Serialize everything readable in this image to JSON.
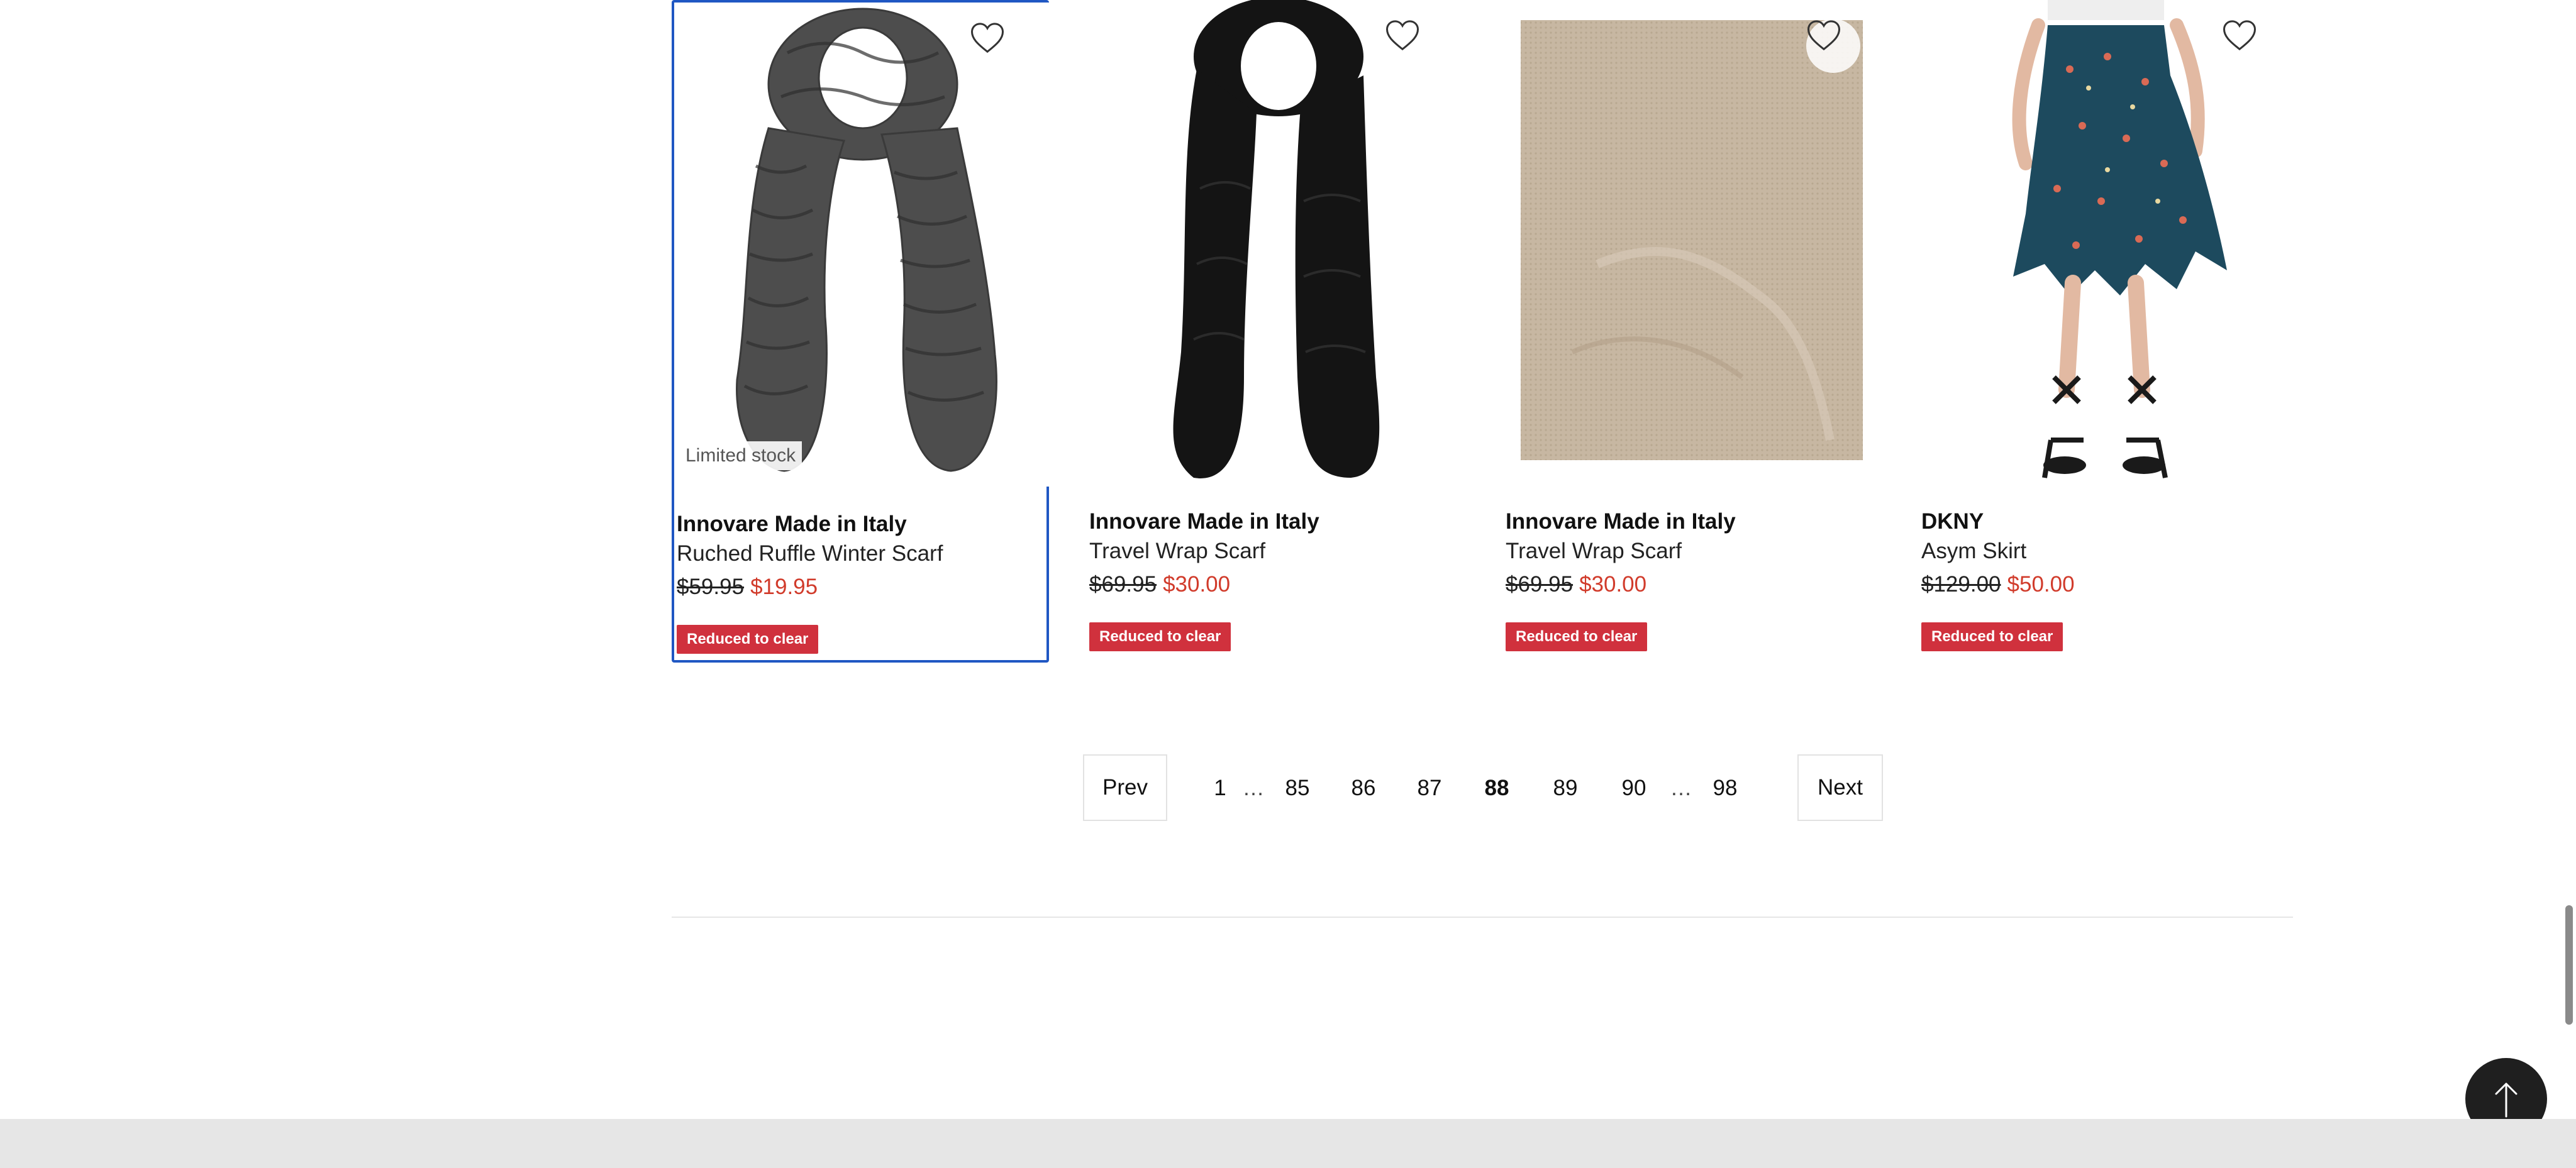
{
  "products": [
    {
      "brand": "Innovare Made in Italy",
      "name": "Ruched Ruffle Winter Scarf",
      "old_price": "$59.95",
      "new_price": "$19.95",
      "badge": "Reduced to clear",
      "limited": "Limited stock",
      "image": "grey-ruffle-scarf",
      "favorite_icon": "heart-outline-icon"
    },
    {
      "brand": "Innovare Made in Italy",
      "name": "Travel Wrap Scarf",
      "old_price": "$69.95",
      "new_price": "$30.00",
      "badge": "Reduced to clear",
      "image": "black-wrap-scarf",
      "favorite_icon": "heart-outline-icon"
    },
    {
      "brand": "Innovare Made in Italy",
      "name": "Travel Wrap Scarf",
      "old_price": "$69.95",
      "new_price": "$30.00",
      "badge": "Reduced to clear",
      "image": "beige-knit-swatch",
      "favorite_icon": "heart-outline-icon"
    },
    {
      "brand": "DKNY",
      "name": "Asym Skirt",
      "old_price": "$129.00",
      "new_price": "$50.00",
      "badge": "Reduced to clear",
      "image": "floral-asymmetric-skirt",
      "favorite_icon": "heart-outline-icon"
    }
  ],
  "pagination": {
    "prev": "Prev",
    "next": "Next",
    "first": "1",
    "ellipsis": "…",
    "pages": [
      "85",
      "86",
      "87",
      "88",
      "89",
      "90"
    ],
    "current": "88",
    "last": "98"
  },
  "back_to_top_icon": "arrow-up-icon",
  "colors": {
    "sale_red": "#d0313d",
    "price_red": "#d13b2b",
    "focus_blue": "#1f57c3"
  }
}
